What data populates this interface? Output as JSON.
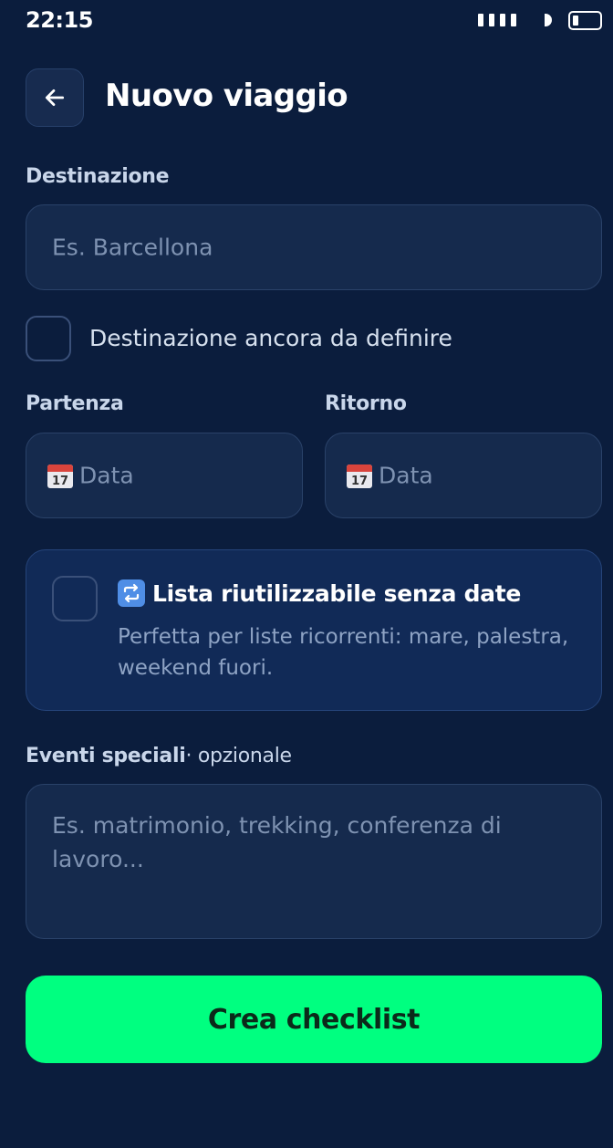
{
  "status_bar": {
    "time": "22:15"
  },
  "header": {
    "title": "Nuovo viaggio"
  },
  "destination": {
    "label": "Destinazione",
    "placeholder": "Es. Barcellona",
    "undefined_checkbox_label": "Destinazione ancora da definire",
    "undefined_checked": false
  },
  "dates": {
    "departure_label": "Partenza",
    "departure_placeholder": "Data",
    "return_label": "Ritorno",
    "return_placeholder": "Data"
  },
  "reusable": {
    "title": "Lista riutilizzabile senza date",
    "description": "Perfetta per liste ricorrenti: mare, palestra, weekend fuori.",
    "checked": false
  },
  "events": {
    "label": "Eventi speciali",
    "optional": "· opzionale",
    "placeholder": "Es. matrimonio, trekking, conferenza di lavoro..."
  },
  "cta": {
    "label": "Crea checklist"
  },
  "colors": {
    "background": "#0b1d3d",
    "field": "#152a4d",
    "accent": "#00ff80",
    "card": "#112a57"
  }
}
